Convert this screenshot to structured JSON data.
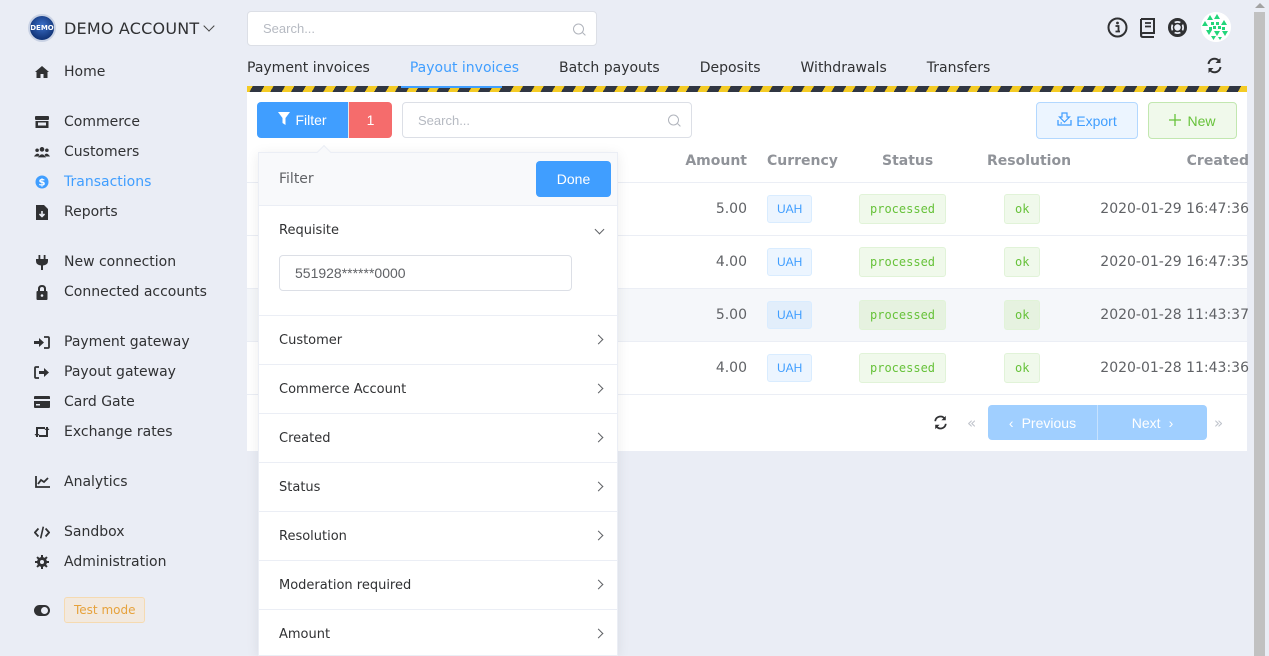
{
  "account": {
    "logo_text": "DEMO",
    "name": "DEMO ACCOUNT"
  },
  "sidebar": {
    "items": [
      {
        "label": "Home",
        "icon": "home-icon"
      },
      {
        "label": "Commerce",
        "icon": "store-icon"
      },
      {
        "label": "Customers",
        "icon": "users-icon"
      },
      {
        "label": "Transactions",
        "icon": "dollar-circle-icon",
        "active": true
      },
      {
        "label": "Reports",
        "icon": "file-download-icon"
      },
      {
        "label": "New connection",
        "icon": "plug-icon"
      },
      {
        "label": "Connected accounts",
        "icon": "lock-icon"
      },
      {
        "label": "Payment gateway",
        "icon": "sign-in-icon"
      },
      {
        "label": "Payout gateway",
        "icon": "sign-out-icon"
      },
      {
        "label": "Card Gate",
        "icon": "credit-card-icon"
      },
      {
        "label": "Exchange rates",
        "icon": "retweet-icon"
      },
      {
        "label": "Analytics",
        "icon": "chart-line-icon"
      },
      {
        "label": "Sandbox",
        "icon": "code-icon"
      },
      {
        "label": "Administration",
        "icon": "cog-icon"
      }
    ],
    "test_mode_label": "Test mode"
  },
  "header": {
    "search_placeholder": "Search...",
    "icons": [
      "info-icon",
      "book-icon",
      "life-ring-icon",
      "avatar"
    ]
  },
  "tabs": [
    {
      "label": "Payment invoices"
    },
    {
      "label": "Payout invoices",
      "active": true
    },
    {
      "label": "Batch payouts"
    },
    {
      "label": "Deposits"
    },
    {
      "label": "Withdrawals"
    },
    {
      "label": "Transfers"
    }
  ],
  "toolbar": {
    "filter_label": "Filter",
    "filter_count": "1",
    "search_placeholder": "Search...",
    "export_label": "Export",
    "new_label": "New"
  },
  "table": {
    "columns": [
      "Amount",
      "Currency",
      "Status",
      "Resolution",
      "Created"
    ],
    "rows": [
      {
        "amount": "5.00",
        "currency": "UAH",
        "status": "processed",
        "resolution": "ok",
        "created": "2020-01-29 16:47:36"
      },
      {
        "amount": "4.00",
        "currency": "UAH",
        "status": "processed",
        "resolution": "ok",
        "created": "2020-01-29 16:47:35"
      },
      {
        "amount": "5.00",
        "currency": "UAH",
        "status": "processed",
        "resolution": "ok",
        "created": "2020-01-28 11:43:37"
      },
      {
        "amount": "4.00",
        "currency": "UAH",
        "status": "processed",
        "resolution": "ok",
        "created": "2020-01-28 11:43:36"
      }
    ]
  },
  "pagination": {
    "previous_label": "Previous",
    "next_label": "Next"
  },
  "filter_panel": {
    "title": "Filter",
    "done_label": "Done",
    "requisite": {
      "label": "Requisite",
      "value": "551928******0000"
    },
    "items": [
      {
        "label": "Customer"
      },
      {
        "label": "Commerce Account"
      },
      {
        "label": "Created"
      },
      {
        "label": "Status"
      },
      {
        "label": "Resolution"
      },
      {
        "label": "Moderation required"
      },
      {
        "label": "Amount"
      }
    ]
  },
  "colors": {
    "primary": "#409eff",
    "danger": "#f56c6c",
    "success": "#67c23a",
    "warning": "#e6a23c",
    "background": "#eaedf5"
  }
}
